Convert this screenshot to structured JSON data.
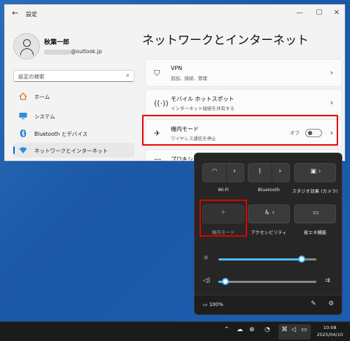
{
  "window": {
    "title": "設定",
    "minimize": "—",
    "maximize": "☐",
    "close": "✕",
    "back": "←"
  },
  "user": {
    "name": "秋葉一郎",
    "email_suffix": "@outlook.jp"
  },
  "search": {
    "placeholder": "設定の検索",
    "icon": "search-icon"
  },
  "sidebar": {
    "items": [
      {
        "label": "ホーム",
        "icon": "home-icon"
      },
      {
        "label": "システム",
        "icon": "monitor-icon"
      },
      {
        "label": "Bluetooth とデバイス",
        "icon": "bluetooth-icon"
      },
      {
        "label": "ネットワークとインターネット",
        "icon": "wifi-icon",
        "active": true
      }
    ]
  },
  "main": {
    "title": "ネットワークとインターネット",
    "cards": [
      {
        "title": "VPN",
        "subtitle": "追加、接続、管理",
        "icon": "shield-icon"
      },
      {
        "title": "モバイル ホットスポット",
        "subtitle": "インターネット接続を共有する",
        "icon": "hotspot-icon"
      },
      {
        "title": "機内モード",
        "subtitle": "ワイヤレス通信を停止",
        "icon": "airplane-icon",
        "toggle_label": "オフ",
        "toggle_on": false
      },
      {
        "title": "プロキシ"
      }
    ]
  },
  "quick_settings": {
    "tiles": [
      {
        "label": "Wi-Fi",
        "icon": "wifi-off-icon"
      },
      {
        "label": "Bluetooth",
        "icon": "bluetooth-icon"
      },
      {
        "label": "スタジオ効果 (カメラ)",
        "icon": "camera-effects-icon"
      },
      {
        "label": "機内モード",
        "icon": "airplane-icon"
      },
      {
        "label": "アクセシビリティ",
        "icon": "accessibility-icon"
      },
      {
        "label": "省エネ機能",
        "icon": "battery-saver-icon"
      }
    ],
    "brightness_percent": 85,
    "volume_percent": 7,
    "battery": "100%",
    "accent": "#4cc2ff"
  },
  "taskbar": {
    "time": "10:08",
    "date": "2025/04/10"
  }
}
